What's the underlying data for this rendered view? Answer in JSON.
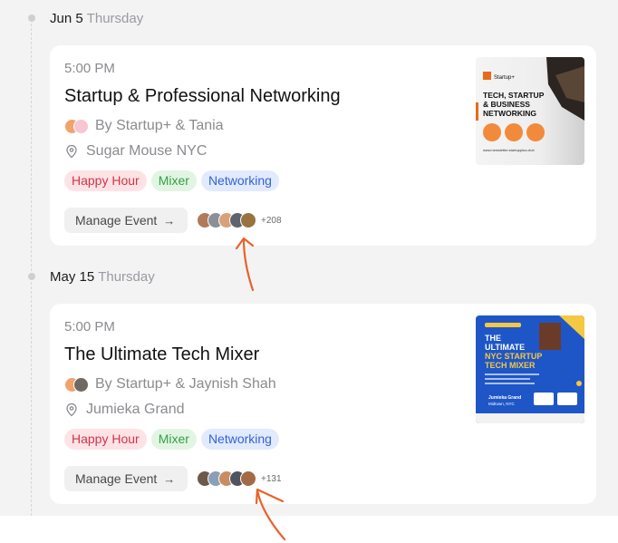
{
  "events": [
    {
      "date": "Jun 5",
      "weekday": "Thursday",
      "time": "5:00 PM",
      "title": "Startup & Professional Networking",
      "hosts": "By Startup+ & Tania",
      "location": "Sugar Mouse NYC",
      "tags": [
        "Happy Hour",
        "Mixer",
        "Networking"
      ],
      "manage_label": "Manage Event",
      "attendee_extra": "+208",
      "flyer": {
        "brand": "Startup+",
        "headline_1": "TECH, STARTUP",
        "headline_2": "& BUSINESS",
        "headline_3": "NETWORKING",
        "url": "www.newsletter.startupplus.club"
      }
    },
    {
      "date": "May 15",
      "weekday": "Thursday",
      "time": "5:00 PM",
      "title": "The Ultimate Tech Mixer",
      "hosts": "By Startup+ & Jaynish Shah",
      "location": "Jumieka Grand",
      "tags": [
        "Happy Hour",
        "Mixer",
        "Networking"
      ],
      "manage_label": "Manage Event",
      "attendee_extra": "+131",
      "flyer": {
        "line_1": "THE",
        "line_2": "ULTIMATE",
        "line_3": "NYC STARTUP",
        "line_4": "TECH MIXER",
        "venue": "Jumieka Grand",
        "city": "Midtown, NYC"
      }
    }
  ],
  "colors": {
    "page_bg": "#f3f3f4",
    "card_bg": "#ffffff",
    "annotation": "#e8632a",
    "tag_red": "#d33446",
    "tag_green": "#34a144",
    "tag_blue": "#3364d8"
  }
}
